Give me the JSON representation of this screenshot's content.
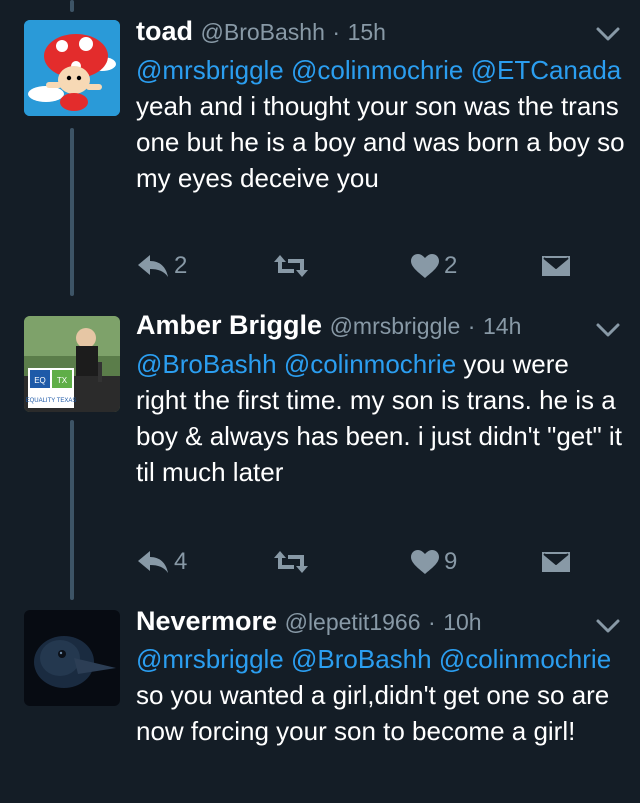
{
  "colors": {
    "background": "#141d26",
    "mention": "#2b9ef0",
    "muted": "#8899a6",
    "thread": "#3d5466"
  },
  "tweets": [
    {
      "name": "toad",
      "handle": "@BroBashh",
      "sep": "·",
      "time": "15h",
      "mentions": [
        "@mrsbriggle",
        "@colinmochrie",
        "@ETCanada"
      ],
      "text": "yeah and i thought your son was the trans one but he is a boy and was born a boy so my eyes deceive you",
      "reply_count": "2",
      "retweet_count": "",
      "like_count": "2",
      "avatar_icon": "toad-mushroom-avatar"
    },
    {
      "name": "Amber Briggle",
      "handle": "@mrsbriggle",
      "sep": "·",
      "time": "14h",
      "mentions": [
        "@BroBashh",
        "@colinmochrie"
      ],
      "text": "you were right the first time. my son is trans. he is a boy & always has been. i just didn't \"get\" it til much later",
      "reply_count": "4",
      "retweet_count": "",
      "like_count": "9",
      "avatar_icon": "equality-texas-podium-avatar",
      "avatar_sign_top_left": "EQ",
      "avatar_sign_top_right": "TX",
      "avatar_sign_bottom": "EQUALITY TEXAS"
    },
    {
      "name": "Nevermore",
      "handle": "@lepetit1966",
      "sep": "·",
      "time": "10h",
      "mentions": [
        "@mrsbriggle",
        "@BroBashh",
        "@colinmochrie"
      ],
      "text": "so you wanted a girl,didn't get one so are now forcing your son to become a girl!",
      "avatar_icon": "raven-avatar"
    }
  ]
}
